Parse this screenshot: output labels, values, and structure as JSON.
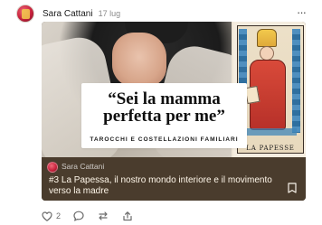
{
  "post": {
    "author": "Sara Cattani",
    "date": "17 lug",
    "more_icon": "···"
  },
  "card": {
    "quote_lines": [
      "“Sei la mamma",
      "perfetta per me”"
    ],
    "subtitle": "TAROCCHI E COSTELLAZIONI FAMILIARI",
    "tarot_label": "LA PAPESSE",
    "footer": {
      "author": "Sara Cattani",
      "title": "#3 La Papessa, il nostro mondo interiore e il movimento verso la madre"
    }
  },
  "actions": {
    "likes": "2"
  }
}
